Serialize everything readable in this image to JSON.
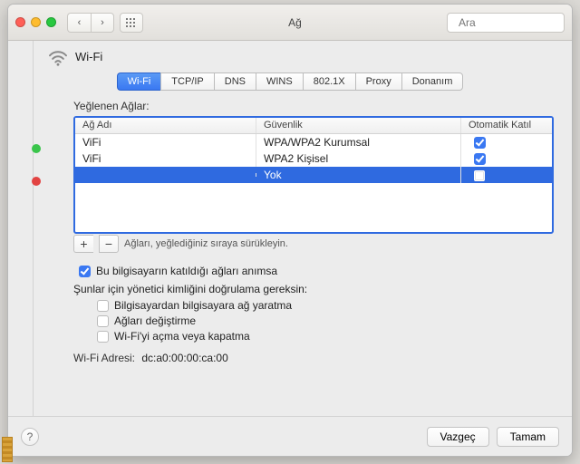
{
  "toolbar": {
    "title": "Ağ",
    "search_placeholder": "Ara"
  },
  "header": {
    "service_name": "Wi-Fi"
  },
  "tabs": [
    {
      "id": "wifi",
      "label": "Wi-Fi",
      "active": true
    },
    {
      "id": "tcpip",
      "label": "TCP/IP",
      "active": false
    },
    {
      "id": "dns",
      "label": "DNS",
      "active": false
    },
    {
      "id": "wins",
      "label": "WINS",
      "active": false
    },
    {
      "id": "8021x",
      "label": "802.1X",
      "active": false
    },
    {
      "id": "proxy",
      "label": "Proxy",
      "active": false
    },
    {
      "id": "hardware",
      "label": "Donanım",
      "active": false
    }
  ],
  "preferred": {
    "label": "Yeğlenen Ağlar:",
    "columns": {
      "name": "Ağ Adı",
      "security": "Güvenlik",
      "auto": "Otomatik Katıl"
    },
    "rows": [
      {
        "name": "ViFi",
        "security": "WPA/WPA2 Kurumsal",
        "auto": true,
        "selected": false
      },
      {
        "name": "ViFi",
        "security": "WPA2 Kişisel",
        "auto": true,
        "selected": false
      },
      {
        "name": "",
        "security": "Yok",
        "auto": false,
        "selected": true
      }
    ],
    "add_label": "+",
    "remove_label": "−",
    "drag_hint": "Ağları, yeğlediğiniz sıraya sürükleyin."
  },
  "options": {
    "remember": {
      "checked": true,
      "label": "Bu bilgisayarın katıldığı ağları anımsa"
    },
    "admin_header": "Şunlar için yönetici kimliğini doğrulama gereksin:",
    "admin": [
      {
        "checked": false,
        "label": "Bilgisayardan bilgisayara ağ yaratma"
      },
      {
        "checked": false,
        "label": "Ağları değiştirme"
      },
      {
        "checked": false,
        "label": "Wi-Fi'yi açma veya kapatma"
      }
    ]
  },
  "wifi_address": {
    "label": "Wi-Fi Adresi:",
    "value": "dc:a0:00:00:ca:00"
  },
  "footer": {
    "cancel": "Vazgeç",
    "ok": "Tamam"
  }
}
